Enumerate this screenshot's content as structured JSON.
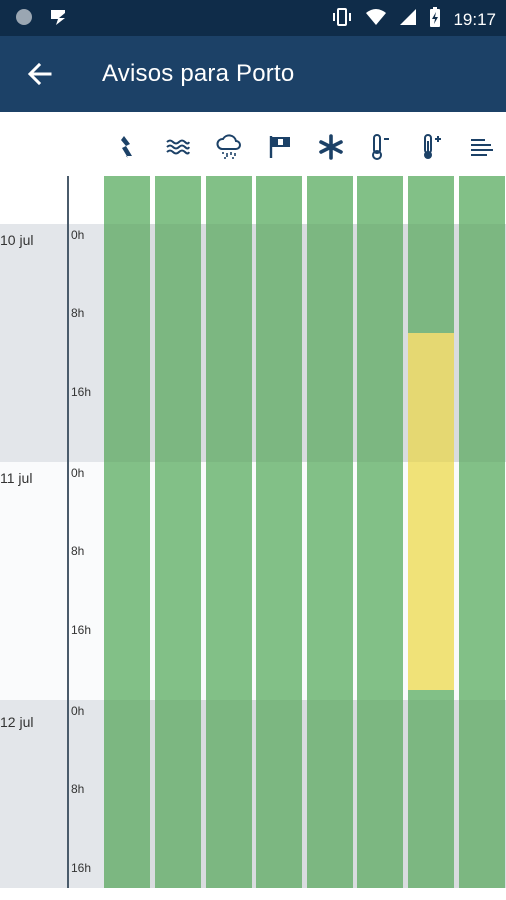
{
  "status_bar": {
    "time": "19:17",
    "icons": [
      "notification-dot-icon",
      "app-notification-icon",
      "vibrate-icon",
      "wifi-icon",
      "signal-icon",
      "battery-charging-icon"
    ]
  },
  "app_bar": {
    "back_icon": "arrow-left-icon",
    "title": "Avisos para Porto"
  },
  "warning_types": [
    {
      "icon": "lightning-icon",
      "name": "thunderstorm"
    },
    {
      "icon": "waves-icon",
      "name": "coastal-agitation"
    },
    {
      "icon": "rain-cloud-icon",
      "name": "precipitation"
    },
    {
      "icon": "wind-flag-icon",
      "name": "wind"
    },
    {
      "icon": "snowflake-icon",
      "name": "snow"
    },
    {
      "icon": "thermometer-cold-icon",
      "name": "cold-weather"
    },
    {
      "icon": "thermometer-hot-icon",
      "name": "hot-weather"
    },
    {
      "icon": "fog-icon",
      "name": "fog"
    }
  ],
  "days": [
    {
      "label": "10 jul",
      "hours": [
        "0h",
        "8h",
        "16h"
      ]
    },
    {
      "label": "11 jul",
      "hours": [
        "0h",
        "8h",
        "16h"
      ]
    },
    {
      "label": "12 jul",
      "hours": [
        "0h",
        "8h",
        "16h"
      ]
    }
  ],
  "colors": {
    "green": "#82c087",
    "yellow": "#f0e278",
    "day_band_gray": "#e3e6ea",
    "header_bg": "#1c4167",
    "statusbar_bg": "#0f2c49"
  },
  "warnings": [
    {
      "column": 6,
      "level": "yellow",
      "start": "10 jul 12h",
      "end": "12 jul 0h"
    }
  ]
}
